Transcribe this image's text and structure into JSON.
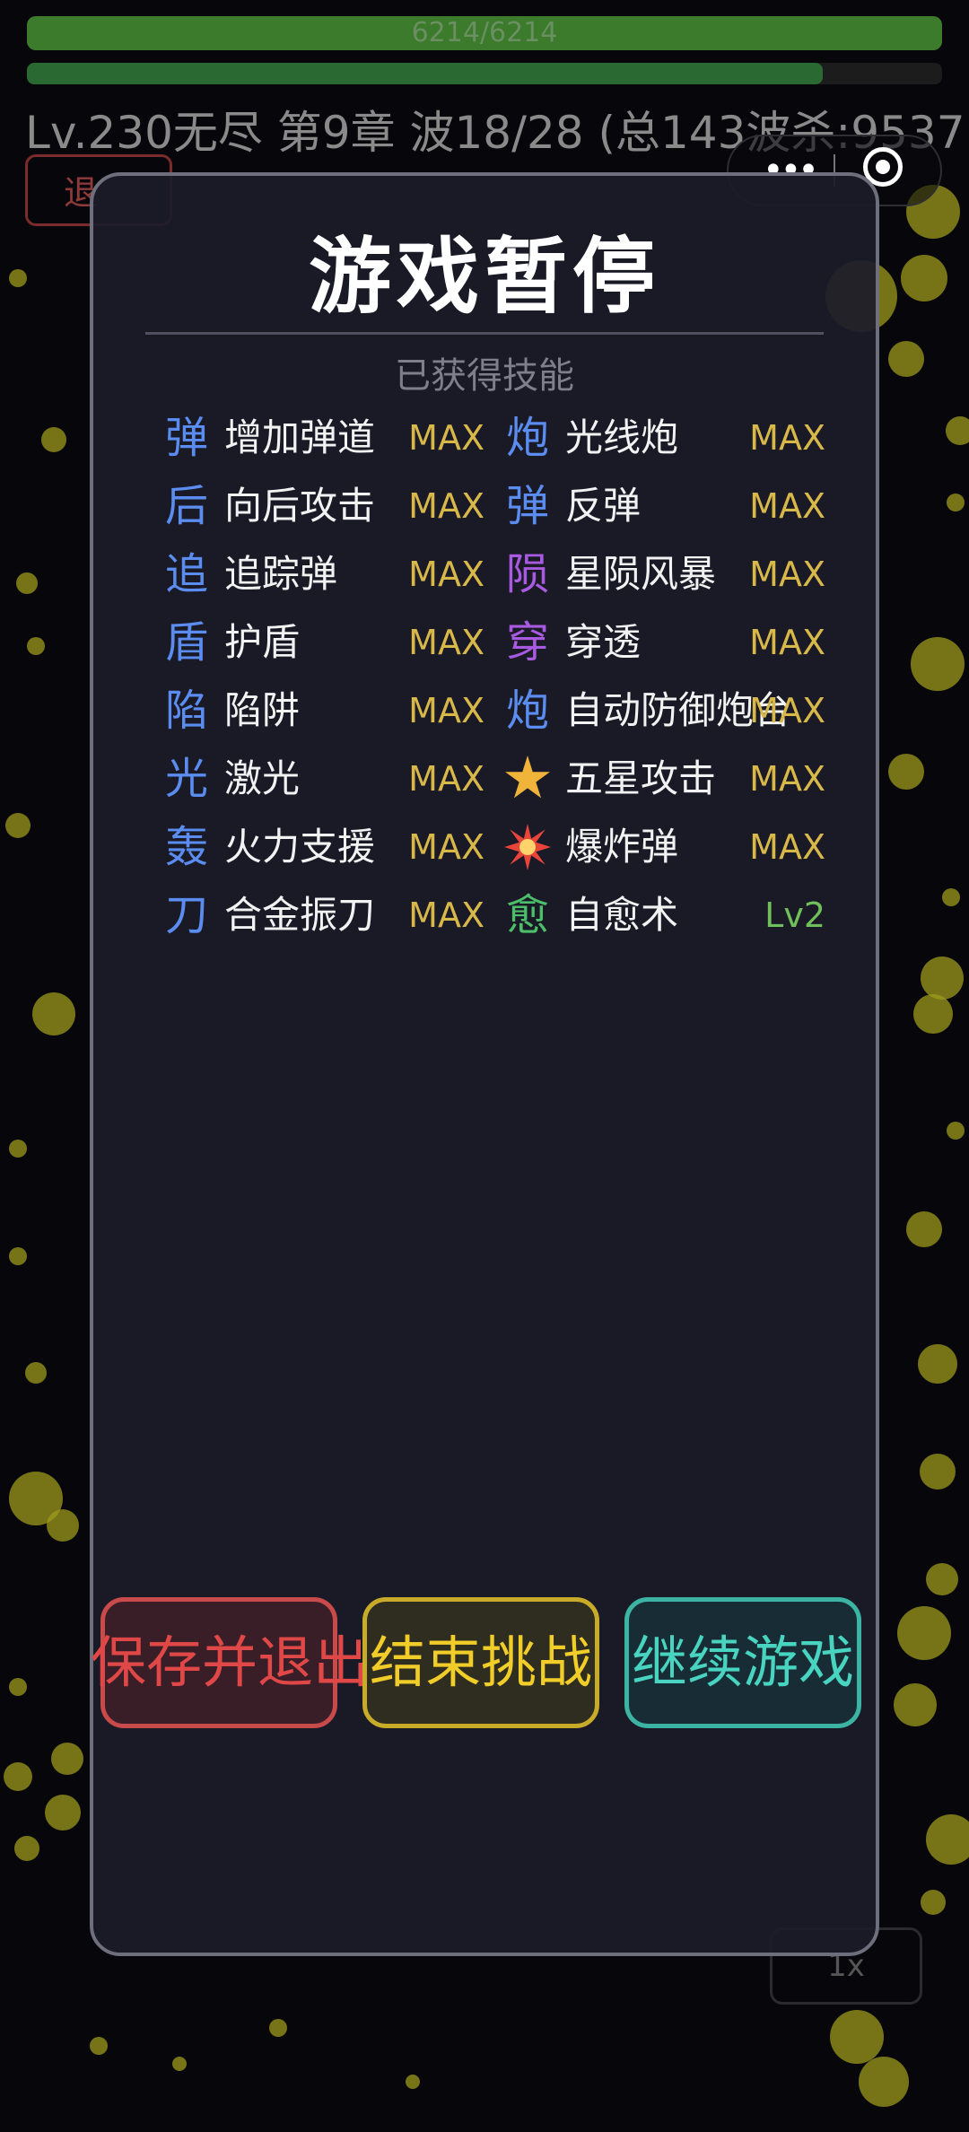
{
  "hud": {
    "hp_text": "6214/6214",
    "hp_fraction": 1.0,
    "xp_fraction": 0.87,
    "status_line": "Lv.230无尽 第9章 波18/28 (总143波杀:9537",
    "exit_button_label": "退",
    "speed_label": "1x"
  },
  "pause": {
    "title": "游戏暂停",
    "section_label": "已获得技能",
    "skills": [
      {
        "glyph": "弹",
        "name": "增加弹道",
        "level": "MAX",
        "glyph_color": "#5b8cf0",
        "level_color": "#d9b84a"
      },
      {
        "glyph": "炮",
        "name": "光线炮",
        "level": "MAX",
        "glyph_color": "#5b8cf0",
        "level_color": "#d9b84a"
      },
      {
        "glyph": "后",
        "name": "向后攻击",
        "level": "MAX",
        "glyph_color": "#5b8cf0",
        "level_color": "#d9b84a"
      },
      {
        "glyph": "弹",
        "name": "反弹",
        "level": "MAX",
        "glyph_color": "#5b8cf0",
        "level_color": "#d9b84a"
      },
      {
        "glyph": "追",
        "name": "追踪弹",
        "level": "MAX",
        "glyph_color": "#5b8cf0",
        "level_color": "#d9b84a"
      },
      {
        "glyph": "陨",
        "name": "星陨风暴",
        "level": "MAX",
        "glyph_color": "#a85ae0",
        "level_color": "#d9b84a"
      },
      {
        "glyph": "盾",
        "name": "护盾",
        "level": "MAX",
        "glyph_color": "#5b8cf0",
        "level_color": "#d9b84a"
      },
      {
        "glyph": "穿",
        "name": "穿透",
        "level": "MAX",
        "glyph_color": "#a85ae0",
        "level_color": "#d9b84a"
      },
      {
        "glyph": "陷",
        "name": "陷阱",
        "level": "MAX",
        "glyph_color": "#5b8cf0",
        "level_color": "#d9b84a"
      },
      {
        "glyph": "炮",
        "name": "自动防御炮台",
        "level": "MAX",
        "glyph_color": "#5b8cf0",
        "level_color": "#d9b84a"
      },
      {
        "glyph": "光",
        "name": "激光",
        "level": "MAX",
        "glyph_color": "#5b8cf0",
        "level_color": "#d9b84a"
      },
      {
        "glyph": "star-icon",
        "name": "五星攻击",
        "level": "MAX",
        "glyph_color": "#f0b43a",
        "level_color": "#d9b84a"
      },
      {
        "glyph": "轰",
        "name": "火力支援",
        "level": "MAX",
        "glyph_color": "#5b8cf0",
        "level_color": "#d9b84a"
      },
      {
        "glyph": "explosion-icon",
        "name": "爆炸弹",
        "level": "MAX",
        "glyph_color": "#e8443a",
        "level_color": "#d9b84a"
      },
      {
        "glyph": "刀",
        "name": "合金振刀",
        "level": "MAX",
        "glyph_color": "#5b8cf0",
        "level_color": "#d9b84a"
      },
      {
        "glyph": "愈",
        "name": "自愈术",
        "level": "Lv2",
        "glyph_color": "#4cbf6a",
        "level_color": "#6fbf5a"
      }
    ],
    "buttons": {
      "save_exit": "保存并退出",
      "end_challenge": "结束挑战",
      "continue": "继续游戏"
    }
  }
}
